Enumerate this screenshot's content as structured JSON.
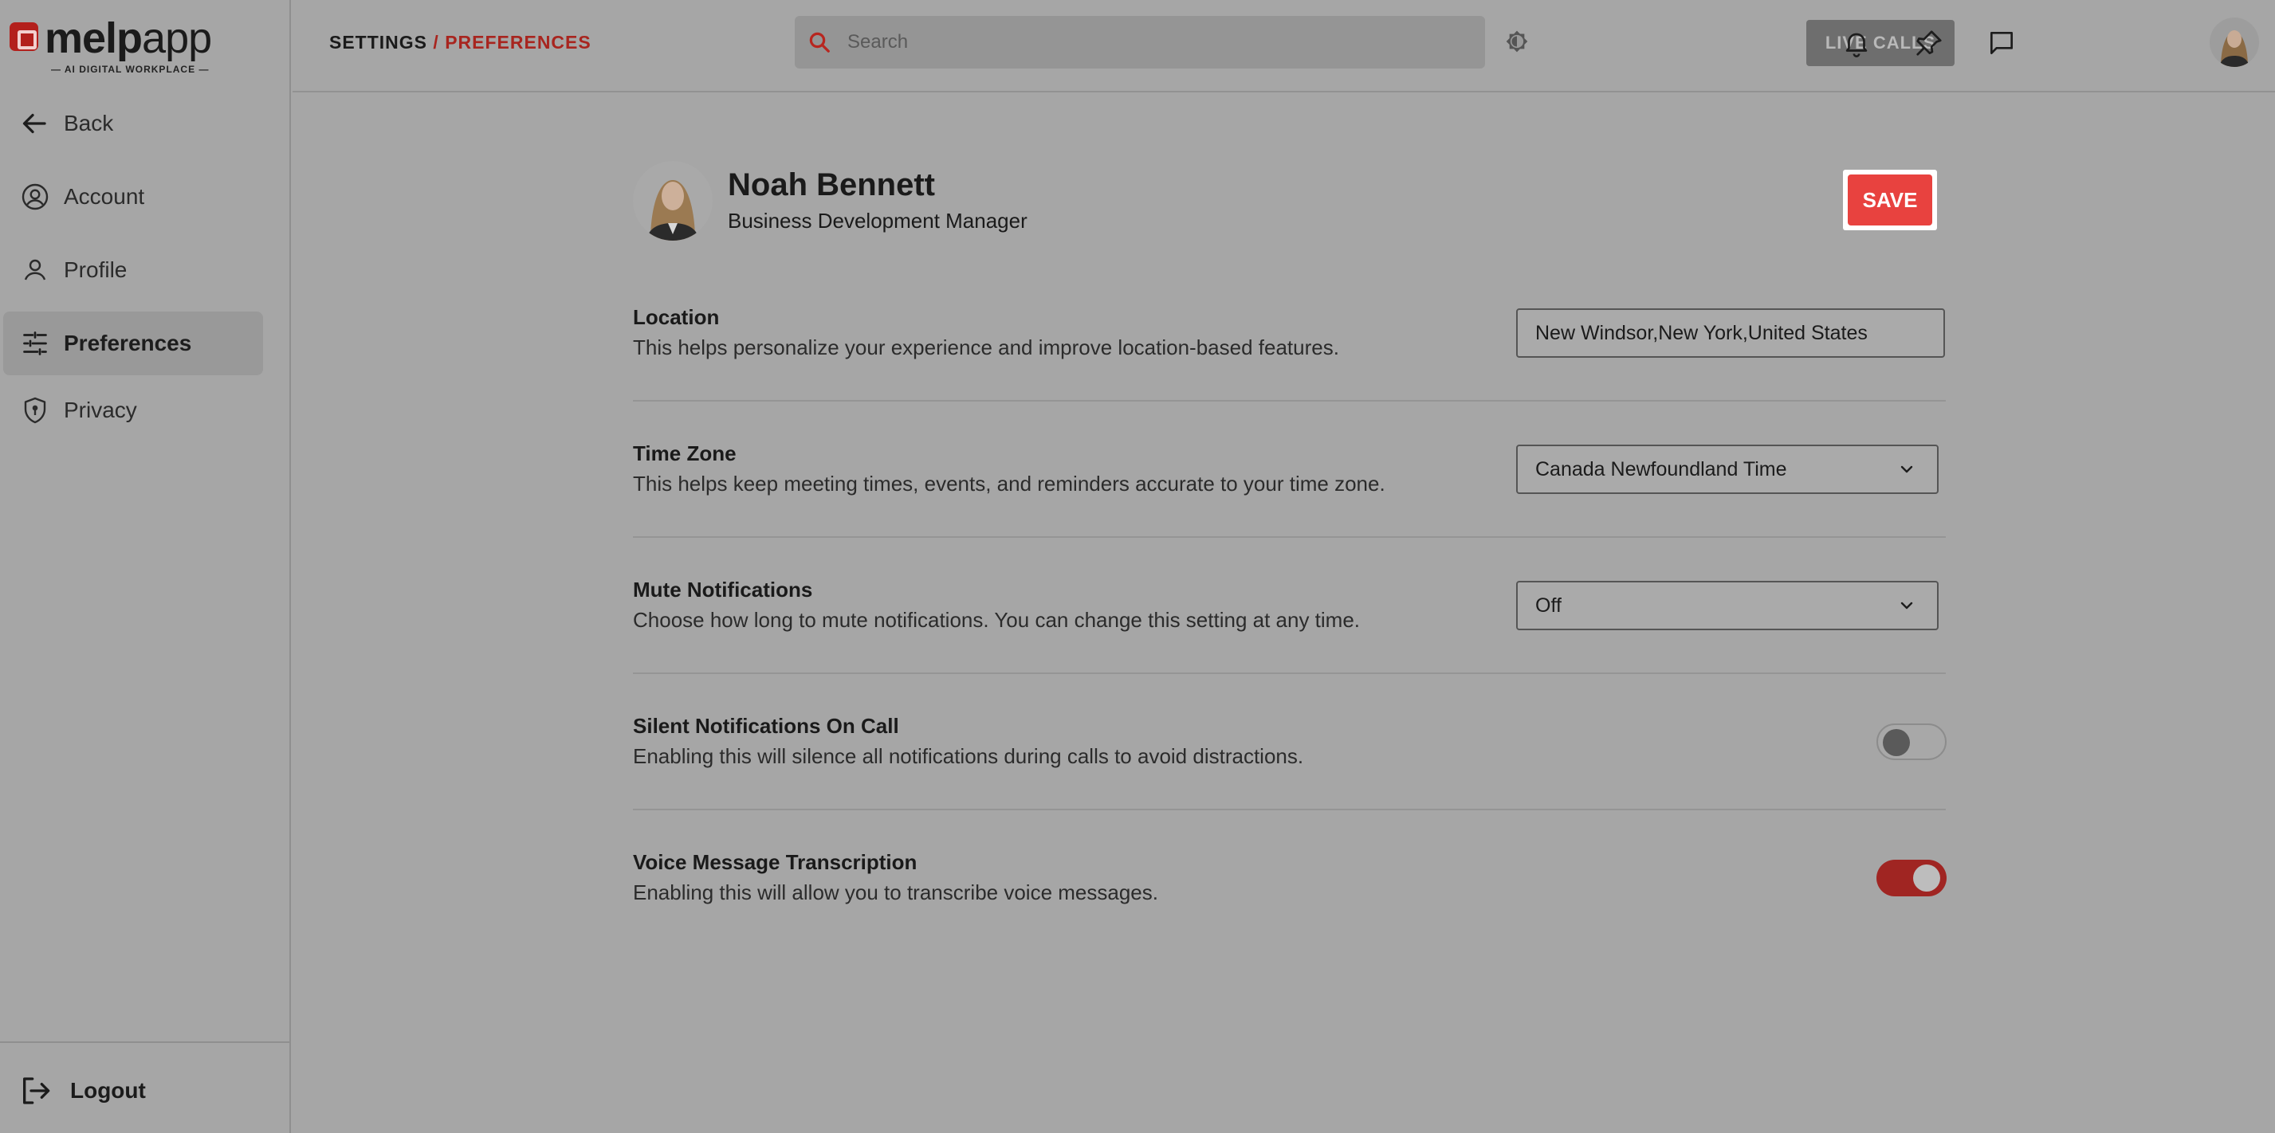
{
  "brand": {
    "name_bold": "melp",
    "name_light": "app",
    "tagline": "— AI DIGITAL WORKPLACE —"
  },
  "sidebar": {
    "back_label": "Back",
    "items": [
      {
        "label": "Account",
        "icon": "user-circle-icon"
      },
      {
        "label": "Profile",
        "icon": "user-icon"
      },
      {
        "label": "Preferences",
        "icon": "sliders-icon",
        "active": true
      },
      {
        "label": "Privacy",
        "icon": "shield-icon"
      }
    ],
    "logout_label": "Logout"
  },
  "header": {
    "breadcrumb_root": "SETTINGS",
    "breadcrumb_sep": " / ",
    "breadcrumb_current": "PREFERENCES",
    "search_placeholder": "Search",
    "live_calls_label": "LIVE CALLS"
  },
  "profile": {
    "name": "Noah Bennett",
    "title": "Business Development Manager"
  },
  "save_label": "SAVE",
  "settings": {
    "location": {
      "title": "Location",
      "desc": "This helps personalize your experience and improve location-based features.",
      "value": "New Windsor,New York,United States"
    },
    "timezone": {
      "title": "Time Zone",
      "desc": "This helps keep meeting times, events, and reminders accurate to your time zone.",
      "value": "Canada Newfoundland Time"
    },
    "mute": {
      "title": "Mute Notifications",
      "desc": "Choose how long to mute notifications. You can change this setting at any time.",
      "value": "Off"
    },
    "silent": {
      "title": "Silent Notifications On Call",
      "desc": "Enabling this will silence all notifications during calls to avoid distractions.",
      "enabled": false
    },
    "transcription": {
      "title": "Voice Message Transcription",
      "desc": "Enabling this will allow you to transcribe voice messages.",
      "enabled": true
    }
  },
  "colors": {
    "accent": "#e8423f",
    "accent_dark": "#a8251f",
    "background": "#a6a6a6"
  }
}
